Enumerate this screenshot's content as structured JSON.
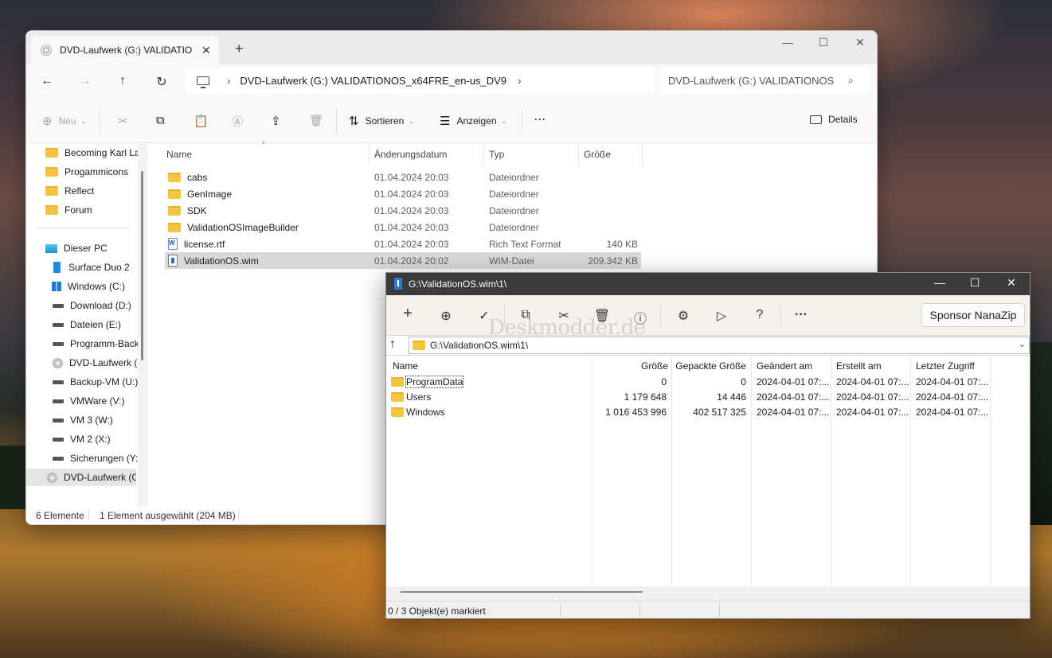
{
  "explorer": {
    "tab_title": "DVD-Laufwerk (G:) VALIDATIO",
    "tab_close": "✕",
    "new_tab": "+",
    "window": {
      "minimize": "—",
      "maximize": "☐",
      "close": "✕"
    },
    "nav": {
      "back": "←",
      "forward": "→",
      "up": "↑",
      "refresh": "↻"
    },
    "address": {
      "chevron": "›",
      "path": "DVD-Laufwerk (G:) VALIDATIONOS_x64FRE_en-us_DV9",
      "end_chevron": "›"
    },
    "search": {
      "placeholder": "DVD-Laufwerk (G:) VALIDATIONOS",
      "icon": "search-icon"
    },
    "toolbar": {
      "new_label": "Neu",
      "sort_label": "Sortieren",
      "view_label": "Anzeigen",
      "more": "···",
      "details_label": "Details",
      "caret": "⌄"
    },
    "sidebar": {
      "quick_items": [
        {
          "label": "Becoming Karl La",
          "icon": "folder-icon"
        },
        {
          "label": "Progammicons",
          "icon": "folder-icon"
        },
        {
          "label": "Reflect",
          "icon": "folder-icon"
        },
        {
          "label": "Forum",
          "icon": "folder-icon"
        }
      ],
      "pc_label": "Dieser PC",
      "drives": [
        {
          "label": "Surface Duo 2",
          "icon": "tablet-icon"
        },
        {
          "label": "Windows (C:)",
          "icon": "windows-drive-icon"
        },
        {
          "label": "Download (D:)",
          "icon": "drive-icon"
        },
        {
          "label": "Dateien (E:)",
          "icon": "drive-icon"
        },
        {
          "label": "Programm-Back",
          "icon": "drive-icon"
        },
        {
          "label": "DVD-Laufwerk (",
          "icon": "dvd-icon"
        },
        {
          "label": "Backup-VM (U:)",
          "icon": "drive-icon"
        },
        {
          "label": "VMWare (V:)",
          "icon": "drive-icon"
        },
        {
          "label": "VM 3 (W:)",
          "icon": "drive-icon"
        },
        {
          "label": "VM 2 (X:)",
          "icon": "drive-icon"
        },
        {
          "label": "Sicherungen (Y:",
          "icon": "drive-icon"
        }
      ],
      "selected_label": "DVD-Laufwerk (G"
    },
    "columns": {
      "name": "Name",
      "modified": "Änderungsdatum",
      "type": "Typ",
      "size": "Größe",
      "sort_arrow": "^"
    },
    "files": [
      {
        "name": "cabs",
        "modified": "01.04.2024 20:03",
        "type": "Dateiordner",
        "size": "",
        "icon": "folder-icon"
      },
      {
        "name": "GenImage",
        "modified": "01.04.2024 20:03",
        "type": "Dateiordner",
        "size": "",
        "icon": "folder-icon"
      },
      {
        "name": "SDK",
        "modified": "01.04.2024 20:03",
        "type": "Dateiordner",
        "size": "",
        "icon": "folder-icon"
      },
      {
        "name": "ValidationOSImageBuilder",
        "modified": "01.04.2024 20:03",
        "type": "Dateiordner",
        "size": "",
        "icon": "folder-icon"
      },
      {
        "name": "license.rtf",
        "modified": "01.04.2024 20:03",
        "type": "Rich Text Format",
        "size": "140 KB",
        "icon": "rtf-file-icon"
      },
      {
        "name": "ValidationOS.wim",
        "modified": "01.04.2024 20:02",
        "type": "WIM-Datei",
        "size": "209.342 KB",
        "icon": "wim-file-icon"
      }
    ],
    "status": {
      "count": "6 Elemente",
      "selection": "1 Element ausgewählt (204 MB)"
    }
  },
  "nanazip": {
    "title": "G:\\ValidationOS.wim\\1\\",
    "window": {
      "minimize": "—",
      "maximize": "☐",
      "close": "✕"
    },
    "toolbar": {
      "add": "+",
      "extract": "⊕",
      "test": "✓",
      "copy": "⧉",
      "move": "✂",
      "delete": "🗑",
      "info": "ⓘ",
      "settings": "⚙",
      "benchmark": "▷",
      "help": "?",
      "more": "···",
      "sponsor_label": "Sponsor NanaZip"
    },
    "watermark": "Deskmodder.de",
    "path": {
      "up": "↑",
      "value": "G:\\ValidationOS.wim\\1\\",
      "dropdown": "⌄"
    },
    "columns": {
      "name": "Name",
      "size": "Größe",
      "packed": "Gepackte Größe",
      "modified": "Geändert am",
      "created": "Erstellt am",
      "accessed": "Letzter Zugriff"
    },
    "rows": [
      {
        "name": "ProgramData",
        "size": "0",
        "packed": "0",
        "modified": "2024-04-01 07:...",
        "created": "2024-04-01 07:...",
        "accessed": "2024-04-01 07:..."
      },
      {
        "name": "Users",
        "size": "1 179 648",
        "packed": "14 446",
        "modified": "2024-04-01 07:...",
        "created": "2024-04-01 07:...",
        "accessed": "2024-04-01 07:..."
      },
      {
        "name": "Windows",
        "size": "1 016 453 996",
        "packed": "402 517 325",
        "modified": "2024-04-01 07:...",
        "created": "2024-04-01 07:...",
        "accessed": "2024-04-01 07:..."
      }
    ],
    "status": "0 / 3 Objekt(e) markiert"
  }
}
